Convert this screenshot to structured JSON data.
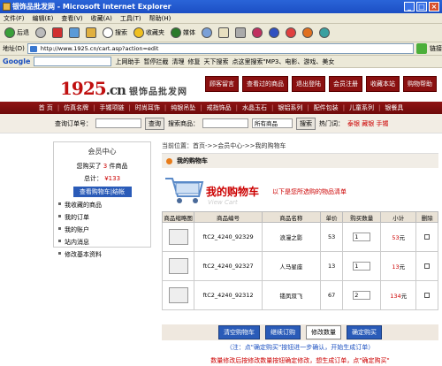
{
  "window": {
    "title": "银饰品批发网 - Microsoft Internet Explorer"
  },
  "menu": [
    "文件(F)",
    "编辑(E)",
    "查看(V)",
    "收藏(A)",
    "工具(T)",
    "帮助(H)"
  ],
  "toolbar": {
    "back": "后退",
    "search": "搜索",
    "favorites": "收藏夹",
    "media": "媒体"
  },
  "address": {
    "label": "地址(D)",
    "url": "http://www.1925.cn/cart.asp?action=edit",
    "links": "链接"
  },
  "googlebar": {
    "brand": "Google",
    "items": [
      "上网助手",
      "暂停拦截",
      "清理",
      "修复",
      "天下搜索",
      "点这里搜索\"MP3、电影、游戏、美女"
    ]
  },
  "site": {
    "logo": "1925",
    "logo_suffix": ".cn",
    "tagline": "银饰品批发网",
    "top_buttons": [
      "顾客留言",
      "查看过的商品",
      "退出登陆",
      "会员注册",
      "收藏本站",
      "购物帮助"
    ],
    "nav": [
      "首 页",
      "仿真名牌",
      "手镯项链",
      "时尚耳饰",
      "纯银吊坠",
      "戒指饰品",
      "水晶玉石",
      "银铝系列",
      "配件包装",
      "儿童系列",
      "银餐具"
    ],
    "search": {
      "order_label": "查询订单号：",
      "order_btn": "查询",
      "product_label": "搜索商品：",
      "category": "所有商品",
      "search_btn": "搜索",
      "hot_label": "热门词：",
      "hot_words": "泰银 藏银 手镯"
    }
  },
  "sidebar": {
    "title": "会员中心",
    "bought_prefix": "您购买了",
    "bought_count": "3",
    "bought_suffix": "件商品",
    "total_label": "总计：",
    "total_value": "¥133",
    "view_cart": "查看购物车|结帐",
    "links": [
      "我收藏的商品",
      "我的订单",
      "我的账户",
      "站内消息",
      "修改基本资料"
    ]
  },
  "main": {
    "breadcrumb": "当前位置：首页->>会员中心->>我的购物车",
    "section_title": "我的购物车",
    "cart_title": "我的购物车",
    "cart_note": "以下是您所选购的物品清单",
    "cart_watermark": "View Cart",
    "columns": [
      "商品缩略图",
      "商品编号",
      "商品名称",
      "单价",
      "购买数量",
      "小计",
      "删除"
    ],
    "rows": [
      {
        "code": "ftC2_4240_92329",
        "name": "浪漫之影",
        "price": "53",
        "qty": "1",
        "subtotal": "53",
        "unit": "元"
      },
      {
        "code": "ftC2_4240_92327",
        "name": "人马星座",
        "price": "13",
        "qty": "1",
        "subtotal": "13",
        "unit": "元"
      },
      {
        "code": "ftC2_4240_92312",
        "name": "镂凤双飞",
        "price": "67",
        "qty": "2",
        "subtotal": "134",
        "unit": "元"
      }
    ],
    "buttons": {
      "clear": "清空购物车",
      "continue": "继续订购",
      "modify": "修改数量",
      "confirm": "确定购买"
    },
    "hint1": "（注：点\"确定购买\"按钮进一步确认，开始生成订单）",
    "hint2": "数量修改后按修改数量按钮确定修改，想生成订单，点\"确定购买\""
  }
}
